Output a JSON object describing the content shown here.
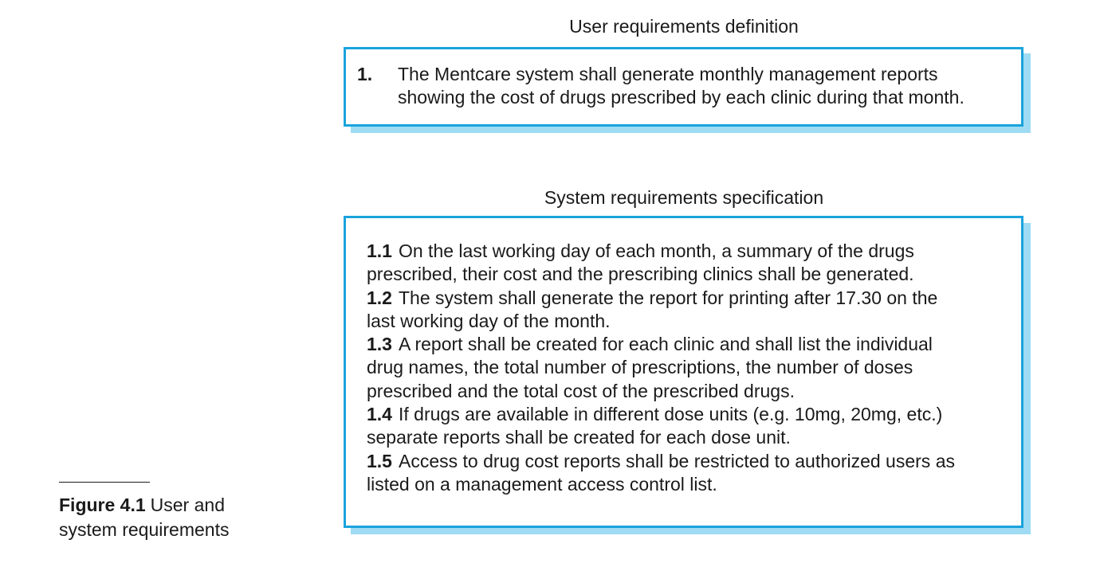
{
  "user_requirements": {
    "heading": "User requirements definition",
    "items": [
      {
        "number": "1.",
        "lines": [
          "The Mentcare system shall generate monthly management reports",
          "showing the cost of drugs prescribed by each clinic during that month."
        ]
      }
    ]
  },
  "system_requirements": {
    "heading": "System requirements specification",
    "items": [
      {
        "number": "1.1",
        "lines": [
          "On the last working day of each month, a summary of the drugs",
          "prescribed, their cost and the prescribing clinics shall be generated."
        ]
      },
      {
        "number": "1.2",
        "lines": [
          "The system shall generate the report for printing after 17.30 on the",
          "last working day of the month."
        ]
      },
      {
        "number": "1.3",
        "lines": [
          "A report shall be created for each clinic and shall list the individual",
          "drug names, the total number of prescriptions, the number of doses",
          "prescribed and the total cost of the prescribed drugs."
        ]
      },
      {
        "number": "1.4",
        "lines": [
          "If drugs are available in different dose units (e.g. 10mg, 20mg, etc.)",
          "separate reports shall be created for each dose unit."
        ]
      },
      {
        "number": "1.5",
        "lines": [
          "Access to drug cost reports shall be restricted to authorized users as",
          "listed on a management access control list."
        ]
      }
    ]
  },
  "caption": {
    "label": "Figure 4.1",
    "line1": "User and",
    "line2": "system requirements"
  },
  "colors": {
    "box_border": "#1aa3dc",
    "box_shadow": "#9fdcf4",
    "text": "#1a1a1a"
  }
}
